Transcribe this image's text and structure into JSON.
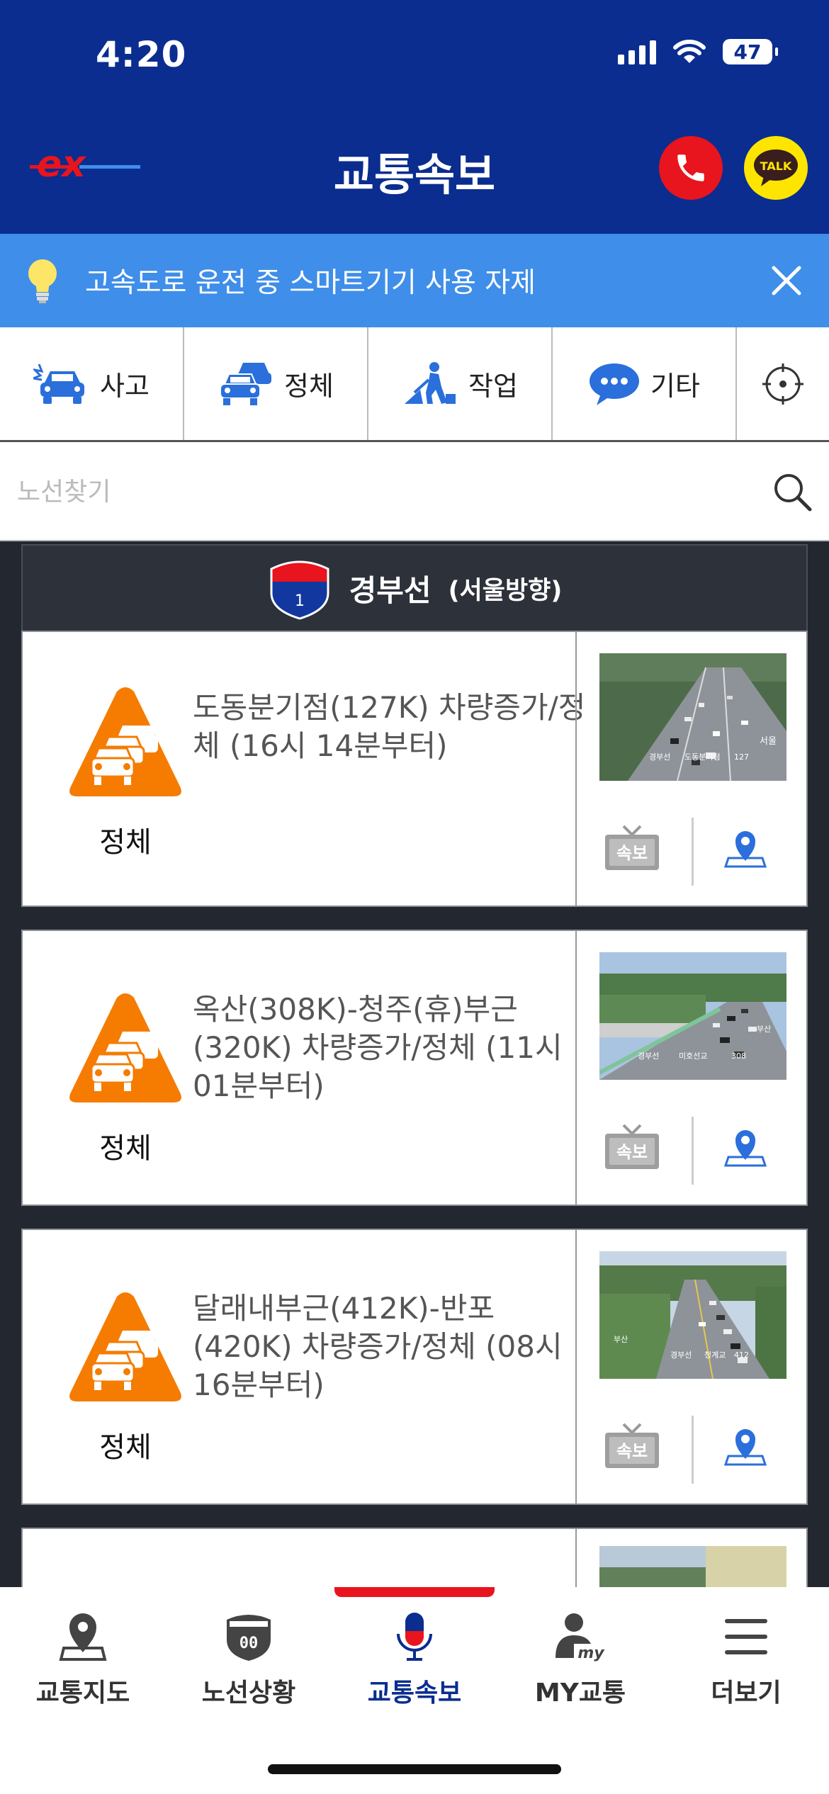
{
  "status_bar": {
    "time": "4:20",
    "battery": "47"
  },
  "header": {
    "logo_text": "ex",
    "title": "교통속보",
    "talk_label": "TALK"
  },
  "notice": {
    "text": "고속도로 운전 중 스마트기기 사용 자제"
  },
  "filters": [
    {
      "label": "사고",
      "icon": "accident-car-icon"
    },
    {
      "label": "정체",
      "icon": "congestion-cars-icon"
    },
    {
      "label": "작업",
      "icon": "roadwork-icon"
    },
    {
      "label": "기타",
      "icon": "chat-bubble-icon"
    }
  ],
  "search": {
    "placeholder": "노선찾기"
  },
  "route": {
    "shield_number": "1",
    "name": "경부선",
    "direction": "(서울방향)"
  },
  "cards": [
    {
      "status": "정체",
      "desc": "도동분기점(127K) 차량증가/정체 (16시 14분부터)",
      "news_label": "속보",
      "cctv_overlay_left": "경부선",
      "cctv_overlay_mid": "도동분기점",
      "cctv_overlay_right": "127",
      "cctv_sign": "서울"
    },
    {
      "status": "정체",
      "desc": "옥산(308K)-청주(휴)부근(320K) 차량증가/정체 (11시 01분부터)",
      "news_label": "속보",
      "cctv_overlay_left": "경부선",
      "cctv_overlay_mid": "미호선교",
      "cctv_overlay_right": "308",
      "cctv_sign": "부산"
    },
    {
      "status": "정체",
      "desc": "달래내부근(412K)-반포(420K) 차량증가/정체 (08시 16분부터)",
      "news_label": "속보",
      "cctv_overlay_left": "경부선",
      "cctv_overlay_mid": "청계교",
      "cctv_overlay_right": "412",
      "cctv_sign": "부산"
    }
  ],
  "tabs": [
    {
      "label": "교통지도",
      "icon": "map-pin-icon"
    },
    {
      "label": "노선상황",
      "icon": "route-shield-icon",
      "badge": "00"
    },
    {
      "label": "교통속보",
      "icon": "microphone-icon",
      "active": true
    },
    {
      "label": "MY교통",
      "icon": "user-my-icon",
      "badge": "my"
    },
    {
      "label": "더보기",
      "icon": "menu-icon"
    }
  ],
  "colors": {
    "header_blue": "#0a2d8f",
    "notice_blue": "#3f8ee9",
    "alert_orange": "#f57c00",
    "accent_red": "#e8141e",
    "talk_yellow": "#fde500"
  }
}
